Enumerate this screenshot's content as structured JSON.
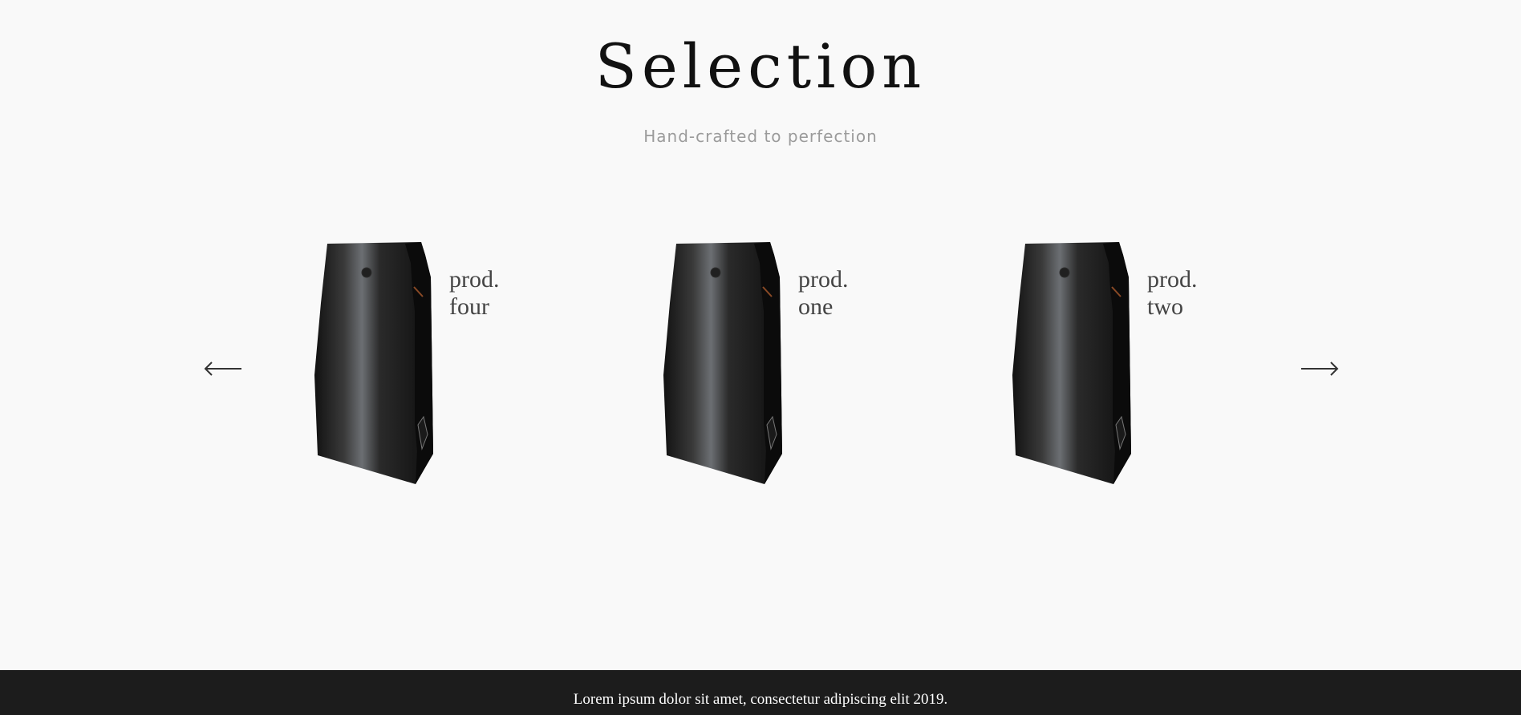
{
  "header": {
    "title": "Selection",
    "subtitle": "Hand-crafted to perfection"
  },
  "carousel": {
    "prev_icon": "arrow-left-icon",
    "next_icon": "arrow-right-icon",
    "products": [
      {
        "line1": "prod.",
        "line2": "four",
        "image": "coffee-bag"
      },
      {
        "line1": "prod.",
        "line2": "one",
        "image": "coffee-bag"
      },
      {
        "line1": "prod.",
        "line2": "two",
        "image": "coffee-bag"
      }
    ]
  },
  "footer": {
    "text": "Lorem ipsum dolor sit amet, consectetur adipiscing elit 2019."
  },
  "colors": {
    "background": "#f9f9f9",
    "footer_background": "#1c1c1c",
    "title": "#111111",
    "subtitle": "#9b9b9b",
    "product_label": "#444444"
  }
}
